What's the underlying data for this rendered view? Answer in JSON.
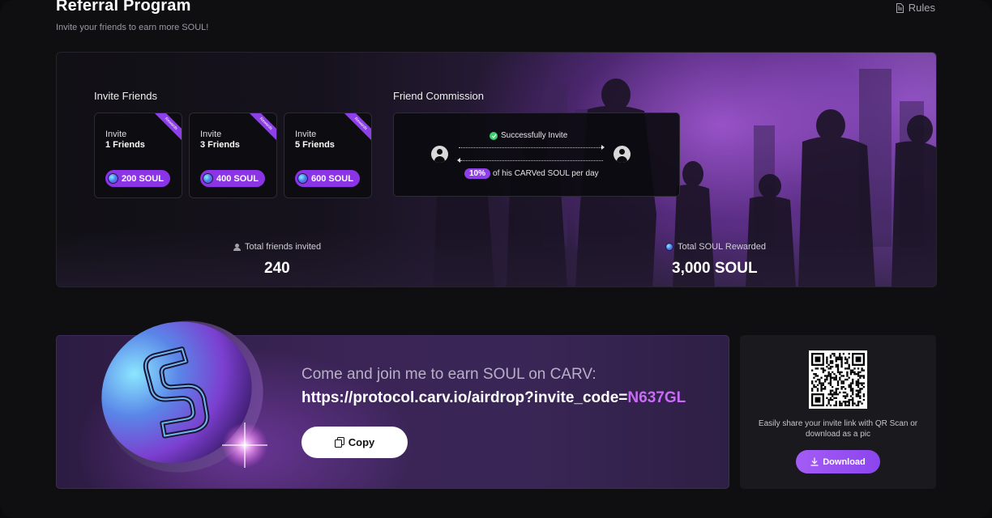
{
  "header": {
    "title": "Referral Program",
    "subtitle": "Invite your friends to earn more SOUL!",
    "rules_label": "Rules"
  },
  "invite_friends": {
    "title": "Invite Friends",
    "cards": [
      {
        "line1": "Invite",
        "line2": "1 Friends",
        "reward": "200 SOUL",
        "ribbon": "Rewards"
      },
      {
        "line1": "Invite",
        "line2": "3 Friends",
        "reward": "400 SOUL",
        "ribbon": "Rewards"
      },
      {
        "line1": "Invite",
        "line2": "5 Friends",
        "reward": "600 SOUL",
        "ribbon": "Rewards"
      }
    ]
  },
  "commission": {
    "title": "Friend Commission",
    "success_text": "Successfully Invite",
    "percent": "10%",
    "percent_text": "of his CARVed SOUL per day"
  },
  "stats": {
    "friends_label": "Total friends invited",
    "friends_value": "240",
    "soul_label": "Total SOUL Rewarded",
    "soul_value": "3,000 SOUL"
  },
  "share": {
    "line1": "Come and join me to earn SOUL on CARV:",
    "link_prefix": "https://protocol.carv.io/airdrop?invite_code=",
    "invite_code": "N637GL",
    "copy_label": "Copy"
  },
  "qr": {
    "caption": "Easily share your invite link with QR Scan or download as a pic",
    "download_label": "Download"
  },
  "colors": {
    "accent": "#8d3fe8",
    "invite_code": "#c86cf7",
    "background": "#0f0f11"
  }
}
